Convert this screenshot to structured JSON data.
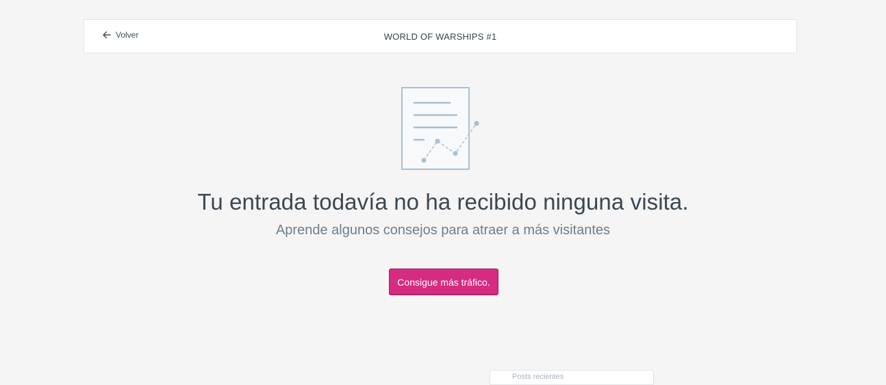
{
  "header": {
    "back_label": "Volver",
    "title": "WORLD OF WARSHIPS #1"
  },
  "empty_state": {
    "headline": "Tu entrada todavía no ha recibido ninguna visita.",
    "subline": "Aprende algunos consejos para atraer a más visitantes",
    "cta_label": "Consigue más tráfico."
  },
  "bottom_card": {
    "partial_text": "Posts recientes"
  },
  "colors": {
    "background": "#f5f5f5",
    "cta": "#d52c82",
    "illustration": "#a8bfd3"
  },
  "icons": {
    "back": "arrow-left-icon",
    "illustration": "document-chart-icon"
  }
}
